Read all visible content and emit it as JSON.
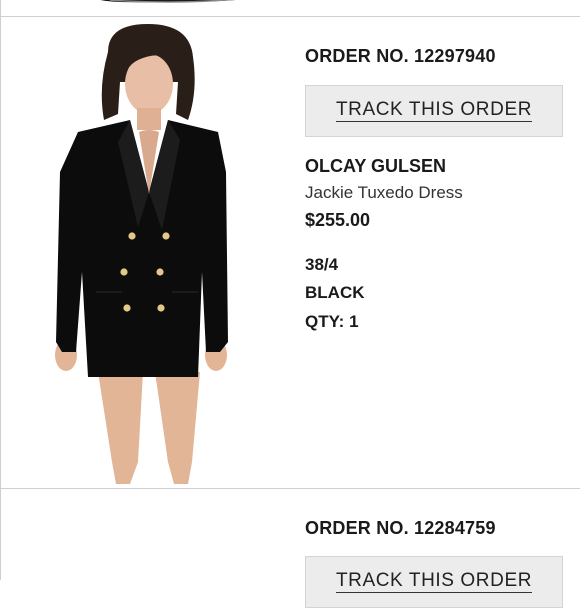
{
  "orders": [
    {
      "order_no": "ORDER NO. 12297940",
      "track_label": "TRACK THIS ORDER",
      "brand": "OLCAY GULSEN",
      "product": "Jackie Tuxedo Dress",
      "price": "$255.00",
      "size": "38/4",
      "color": "BLACK",
      "qty": "QTY: 1",
      "image_icon": "tuxedo-dress-photo"
    },
    {
      "order_no": "ORDER NO. 12284759",
      "track_label": "TRACK THIS ORDER"
    }
  ],
  "colors": {
    "divider": "#cfcfcf",
    "button_bg": "#ececec",
    "dress": "#0c0c0c",
    "buttons_gold": "#e2c98a"
  }
}
